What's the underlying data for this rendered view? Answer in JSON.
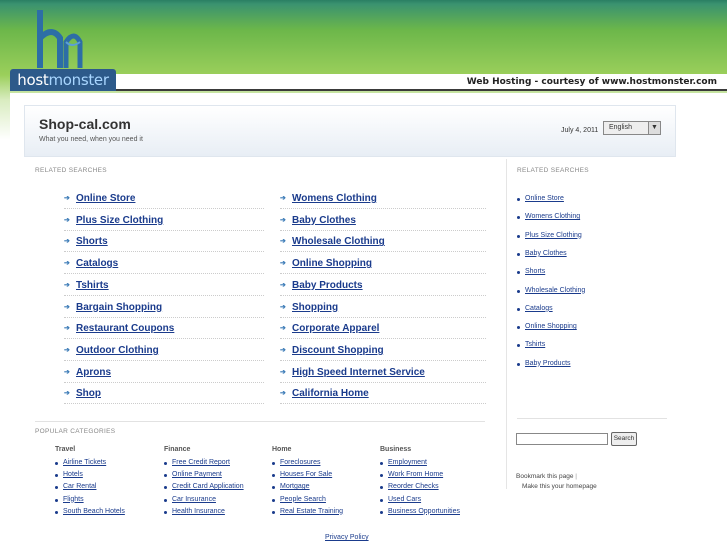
{
  "header": {
    "logo_host": "host",
    "logo_monster": "monster",
    "courtesy": "Web Hosting - courtesy of www.hostmonster.com"
  },
  "site": {
    "title": "Shop-cal.com",
    "tagline": "What you need, when you need it",
    "date": "July 4, 2011",
    "language": "English"
  },
  "related": {
    "label": "RELATED SEARCHES",
    "left_col": [
      "Online Store",
      "Plus Size Clothing",
      "Shorts",
      "Catalogs",
      "Tshirts",
      "Bargain Shopping",
      "Restaurant Coupons",
      "Outdoor Clothing",
      "Aprons",
      "Shop"
    ],
    "right_col": [
      "Womens Clothing",
      "Baby Clothes",
      "Wholesale Clothing",
      "Online Shopping",
      "Baby Products",
      "Shopping",
      "Corporate Apparel",
      "Discount Shopping",
      "High Speed Internet Service",
      "California Home"
    ]
  },
  "sidebar": {
    "label": "RELATED SEARCHES",
    "items": [
      "Online Store",
      "Womens Clothing",
      "Plus Size Clothing",
      "Baby Clothes",
      "Shorts",
      "Wholesale Clothing",
      "Catalogs",
      "Online Shopping",
      "Tshirts",
      "Baby Products"
    ],
    "search_button": "Search",
    "bookmark": "Bookmark this page",
    "homepage": "Make this your homepage"
  },
  "popular": {
    "label": "POPULAR CATEGORIES",
    "groups": [
      {
        "title": "Travel",
        "items": [
          "Airline Tickets",
          "Hotels",
          "Car Rental",
          "Flights",
          "South Beach Hotels"
        ]
      },
      {
        "title": "Finance",
        "items": [
          "Free Credit Report",
          "Online Payment",
          "Credit Card Application",
          "Car Insurance",
          "Health Insurance"
        ]
      },
      {
        "title": "Home",
        "items": [
          "Foreclosures",
          "Houses For Sale",
          "Mortgage",
          "People Search",
          "Real Estate Training"
        ]
      },
      {
        "title": "Business",
        "items": [
          "Employment",
          "Work From Home",
          "Reorder Checks",
          "Used Cars",
          "Business Opportunities"
        ]
      }
    ]
  },
  "footer": {
    "privacy": "Privacy Policy"
  },
  "colors": {
    "link": "#1a3b8c",
    "brand_blue": "#2d5a8a",
    "green": "#6cb74a"
  }
}
